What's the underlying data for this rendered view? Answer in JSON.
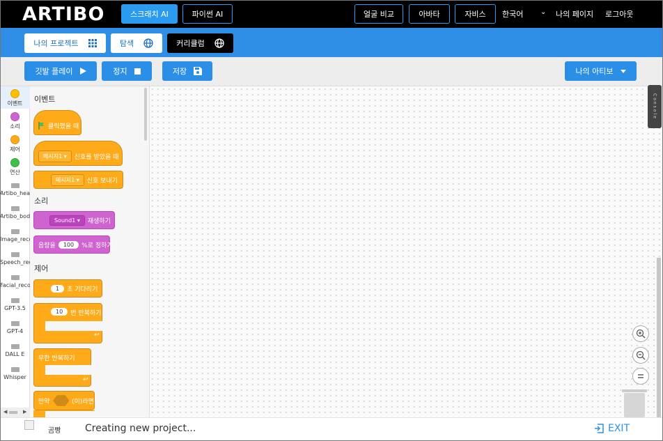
{
  "header": {
    "logo": "ARTIBO",
    "tab_scratch": "스크래치 AI",
    "tab_python": "파이썬 AI",
    "face_compare": "얼굴 비교",
    "avatar": "아바타",
    "jarvis": "자비스",
    "language": "한국어",
    "my_page": "나의 페이지",
    "logout": "로그아웃"
  },
  "nav": {
    "my_projects": "나의 프로젝트",
    "explore": "탐색",
    "curriculum": "커리큘럼"
  },
  "actions": {
    "flag_play": "깃발 플레이",
    "stop": "정지",
    "save": "저장",
    "my_artibo": "나의 아티보"
  },
  "categories": [
    {
      "label": "이벤트",
      "color": "#ffbf00",
      "type": "dot"
    },
    {
      "label": "소리",
      "color": "#cf63cf",
      "type": "dot"
    },
    {
      "label": "제어",
      "color": "#ffab19",
      "type": "dot"
    },
    {
      "label": "연산",
      "color": "#40bf4a",
      "type": "dot"
    },
    {
      "label": "Artibo_head",
      "type": "ext"
    },
    {
      "label": "Artibo_body",
      "type": "ext"
    },
    {
      "label": "Image_recog",
      "type": "ext"
    },
    {
      "label": "Speech_reco",
      "type": "ext"
    },
    {
      "label": "Facial_recog",
      "type": "ext"
    },
    {
      "label": "GPT-3.5",
      "type": "ext"
    },
    {
      "label": "GPT-4",
      "type": "ext"
    },
    {
      "label": "DALL E",
      "type": "ext"
    },
    {
      "label": "Whisper",
      "type": "ext"
    }
  ],
  "palette": {
    "events_heading": "이벤트",
    "when_flag_clicked": "클릭했을 때",
    "message1": "메시지1 ▾",
    "when_receive": "신호를 받았을 때",
    "message1b": "메시지1 ▾",
    "broadcast": "신호 보내기",
    "sound_heading": "소리",
    "sound1": "Sound1 ▾",
    "play_sound": "재생하기",
    "volume_prefix": "음량을",
    "volume_value": "100",
    "volume_suffix": "%로 정하기",
    "control_heading": "제어",
    "wait_value": "1",
    "wait_label": "초 기다리기",
    "repeat_value": "10",
    "repeat_label": "번 반복하기",
    "forever_label": "무한 반복하기",
    "if_prefix": "만약",
    "if_suffix": "(이)라면"
  },
  "canvas": {
    "console_label": "Console"
  },
  "footer": {
    "sprite_name": "곰빵",
    "status": "Creating new project...",
    "exit": "EXIT"
  },
  "colors": {
    "accent": "#2b9bf0",
    "toolbar_blue": "#2f8fe6",
    "events": "#ffbf00",
    "sound": "#cf63cf",
    "control": "#ffab19"
  }
}
